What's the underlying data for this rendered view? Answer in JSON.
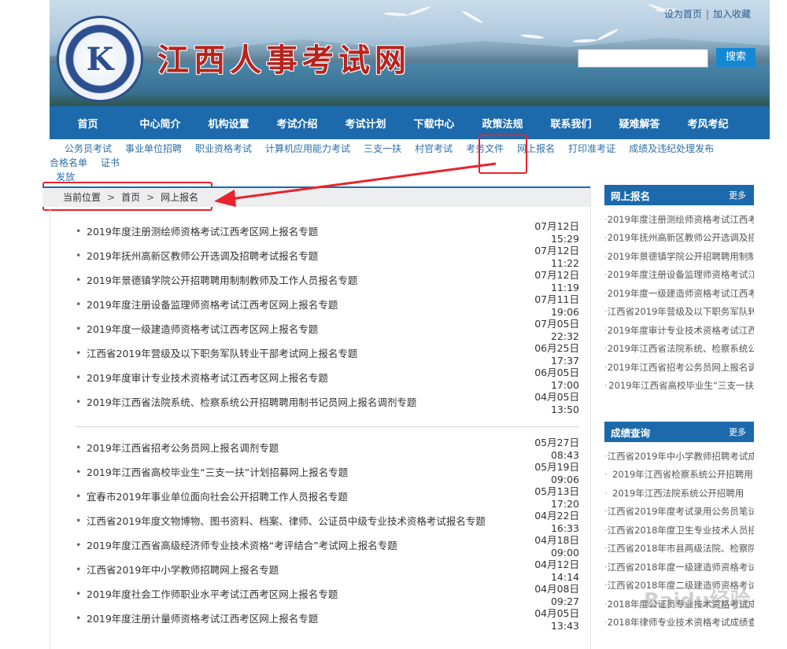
{
  "header": {
    "site_title": "江西人事考试网",
    "logo_letter": "K",
    "top_links": [
      "设为首页",
      "加入收藏"
    ],
    "top_links_sep": "|",
    "search_button": "搜索",
    "search_placeholder": ""
  },
  "main_nav": [
    "首页",
    "中心简介",
    "机构设置",
    "考试介绍",
    "考试计划",
    "下载中心",
    "政策法规",
    "联系我们",
    "疑难解答",
    "考风考纪"
  ],
  "sub_nav": {
    "row1": [
      "公务员考试",
      "事业单位招聘",
      "职业资格考试",
      "计算机应用能力考试",
      "三支一扶",
      "村官考试",
      "考务文件",
      "网上报名",
      "打印准考证",
      "成绩及违纪处理发布",
      "合格名单",
      "证书"
    ],
    "row2": [
      "发放"
    ]
  },
  "breadcrumb": {
    "label": "当前位置",
    "sep": ">",
    "items": [
      "首页",
      "网上报名"
    ]
  },
  "list_section1": [
    {
      "title": "2019年度注册测绘师资格考试江西考区网上报名专题",
      "date": "07月12日15:29"
    },
    {
      "title": "2019年抚州高新区教师公开选调及招聘考试报名专题",
      "date": "07月12日11:22"
    },
    {
      "title": "2019年景德镇学院公开招聘聘用制制教师及工作人员报名专题",
      "date": "07月12日11:19"
    },
    {
      "title": "2019年度注册设备监理师资格考试江西考区网上报名专题",
      "date": "07月11日19:06"
    },
    {
      "title": "2019年度一级建造师资格考试江西考区网上报名专题",
      "date": "07月05日22:32"
    },
    {
      "title": "江西省2019年营级及以下职务军队转业干部考试网上报名专题",
      "date": "06月25日17:37"
    },
    {
      "title": "2019年度审计专业技术资格考试江西考区网上报名专题",
      "date": "06月05日17:00"
    },
    {
      "title": "2019年江西省法院系统、检察系统公开招聘聘用制书记员网上报名调剂专题",
      "date": "04月05日13:50"
    }
  ],
  "list_section2": [
    {
      "title": "2019年江西省招考公务员网上报名调剂专题",
      "date": "05月27日08:43"
    },
    {
      "title": "2019年江西省高校毕业生“三支一扶”计划招募网上报名专题",
      "date": "05月19日09:06"
    },
    {
      "title": "宜春市2019年事业单位面向社会公开招聘工作人员报名专题",
      "date": "05月13日17:20"
    },
    {
      "title": "江西省2019年度文物博物、图书资料、档案、律师、公证员中级专业技术资格考试报名专题",
      "date": "04月22日16:33"
    },
    {
      "title": "2019年度江西省高级经济师专业技术资格“考评结合”考试网上报名专题",
      "date": "04月18日09:00"
    },
    {
      "title": "江西省2019年中小学教师招聘网上报名专题",
      "date": "04月12日14:14"
    },
    {
      "title": "2019年度社会工作师职业水平考试江西考区网上报名专题",
      "date": "04月08日09:27"
    },
    {
      "title": "2019年度注册计量师资格考试江西考区网上报名专题",
      "date": "04月05日13:43"
    }
  ],
  "sidebar": {
    "box1": {
      "title": "网上报名",
      "more": "更多",
      "items": [
        "2019年度注册测绘师资格考试江西考",
        "2019年抚州高新区教师公开选调及招",
        "2019年景德镇学院公开招聘聘用制制",
        "2019年度注册设备监理师资格考试江",
        "2019年度一级建造师资格考试江西考",
        "江西省2019年营级及以下职务军队转",
        "2019年度审计专业技术资格考试江西",
        "2019年江西省法院系统、检察系统公",
        "2019年江西省招考公务员网上报名调",
        "2019年江西省高校毕业生“三支一扶"
      ]
    },
    "box2": {
      "title": "成绩查询",
      "more": "更多",
      "items": [
        "江西省2019年中小学教师招聘考试成",
        "2019年江西省检察系统公开招聘用",
        "2019年江西法院系统公开招聘用",
        "江西省2019年度考试录用公务员笔试",
        "江西省2018年度卫生专业技术人员招",
        "江西省2018年市县两级法院、检察院",
        "江西省2018年度一级建造师资格考试",
        "江西省2018年度二级建造师资格考试",
        "2018年度公证员专业技术资格考试成",
        "2018年律师专业技术资格考试成绩查"
      ]
    }
  },
  "watermark": "Baidu经验"
}
